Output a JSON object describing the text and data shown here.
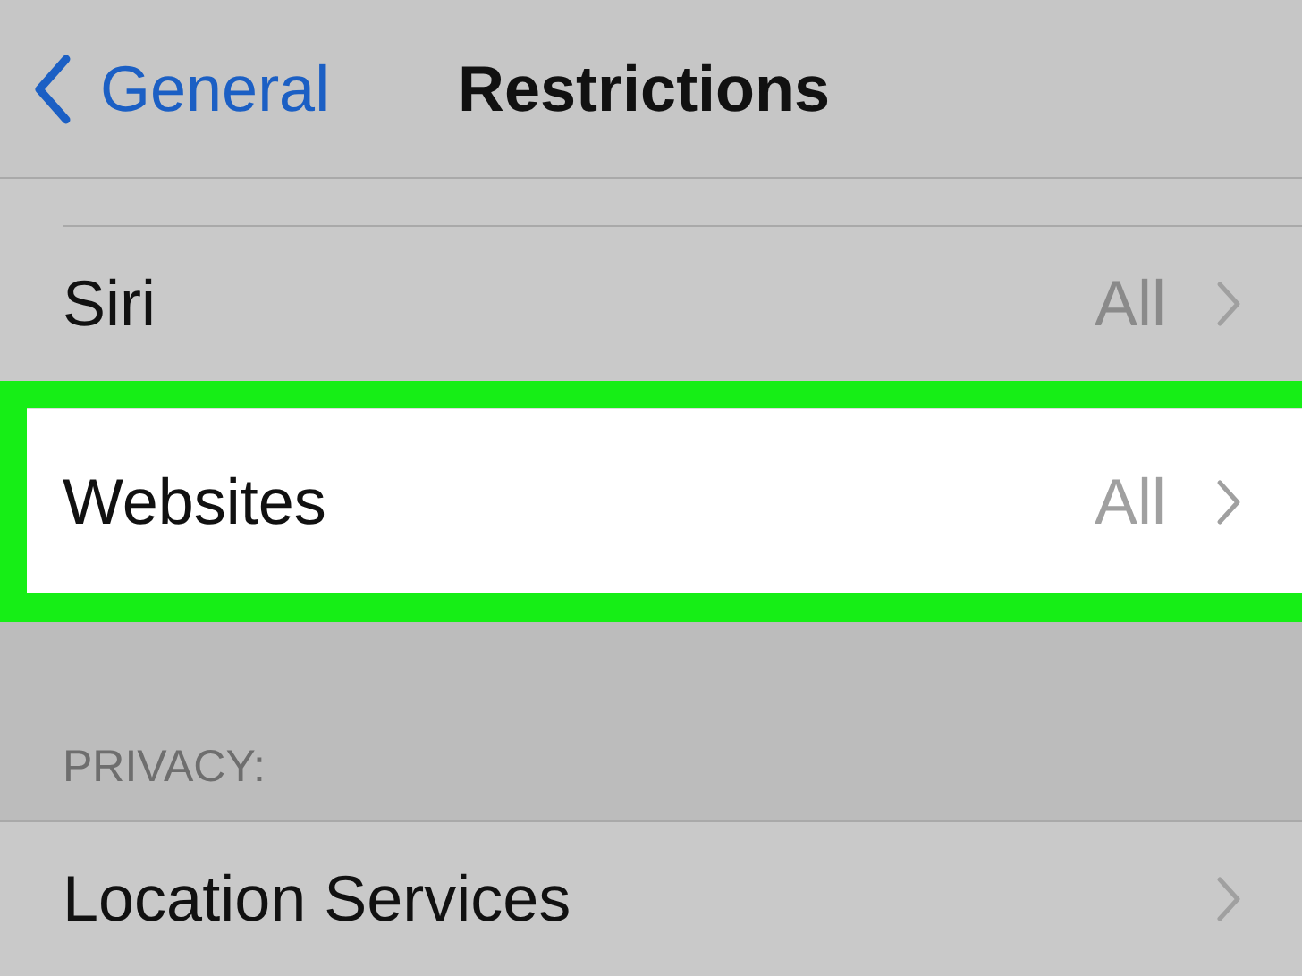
{
  "nav_bar": {
    "back_label": "General",
    "title": "Restrictions"
  },
  "sections": [
    {
      "rows": [
        {
          "label": "Siri",
          "value": "All",
          "highlighted": false
        },
        {
          "label": "Websites",
          "value": "All",
          "highlighted": true
        }
      ]
    },
    {
      "header": "PRIVACY:",
      "rows": [
        {
          "label": "Location Services",
          "highlighted": false
        }
      ]
    }
  ]
}
